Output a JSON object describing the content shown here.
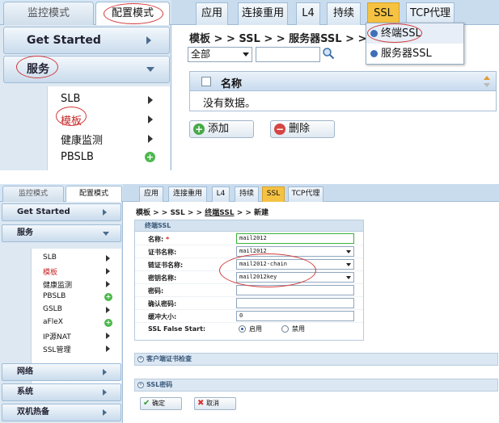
{
  "top": {
    "left_tabs": [
      "监控模式",
      "配置模式"
    ],
    "sidebar": {
      "get_started": "Get Started",
      "service": "服务",
      "sub_items": [
        "SLB",
        "模板",
        "健康监测",
        "PBSLB"
      ]
    },
    "tabs": [
      "应用",
      "连接重用",
      "L4",
      "持续",
      "SSL",
      "TCP代理"
    ],
    "breadcrumb": "模板 > > SSL > > 服务器SSL > > 列",
    "filter_select": "全部",
    "table": {
      "header": "名称",
      "empty": "没有数据。"
    },
    "buttons": {
      "add": "添加",
      "delete": "删除"
    },
    "ssl_menu": [
      "终端SSL",
      "服务器SSL"
    ]
  },
  "bottom": {
    "left_tabs": [
      "监控模式",
      "配置模式"
    ],
    "sidebar": {
      "get_started": "Get Started",
      "service": "服务",
      "sub_items": [
        "SLB",
        "模板",
        "健康监测",
        "PBSLB",
        "GSLB",
        "aFleX",
        "IP源NAT",
        "SSL管理"
      ],
      "more_sections": [
        "网络",
        "系统",
        "双机热备"
      ]
    },
    "tabs": [
      "应用",
      "连接重用",
      "L4",
      "持续",
      "SSL",
      "TCP代理"
    ],
    "breadcrumb": {
      "p1": "模板 > > SSL > > ",
      "link": "终端SSL",
      "p2": " > > 新建"
    },
    "panel_title": "终端SSL",
    "form": {
      "name_label": "名称:",
      "required_mark": "*",
      "name_value": "mail2012",
      "cert_label": "证书名称:",
      "cert_value": "mail2012",
      "chain_label": "链证书名称:",
      "chain_value": "mail2012-chain",
      "key_label": "密钥名称:",
      "key_value": "mail2012key",
      "password_label": "密码:",
      "confirm_label": "确认密码:",
      "buffer_label": "缓冲大小:",
      "buffer_value": "0",
      "false_start_label": "SSL False Start:",
      "enable": "启用",
      "disable": "禁用"
    },
    "collapsed": [
      "客户端证书检查",
      "SSL密码"
    ],
    "buttons": {
      "ok": "确定",
      "cancel": "取消"
    }
  },
  "colors": {
    "accent_tab": "#f5c242",
    "annotation": "#d23b3b",
    "required": "#dd2222"
  }
}
